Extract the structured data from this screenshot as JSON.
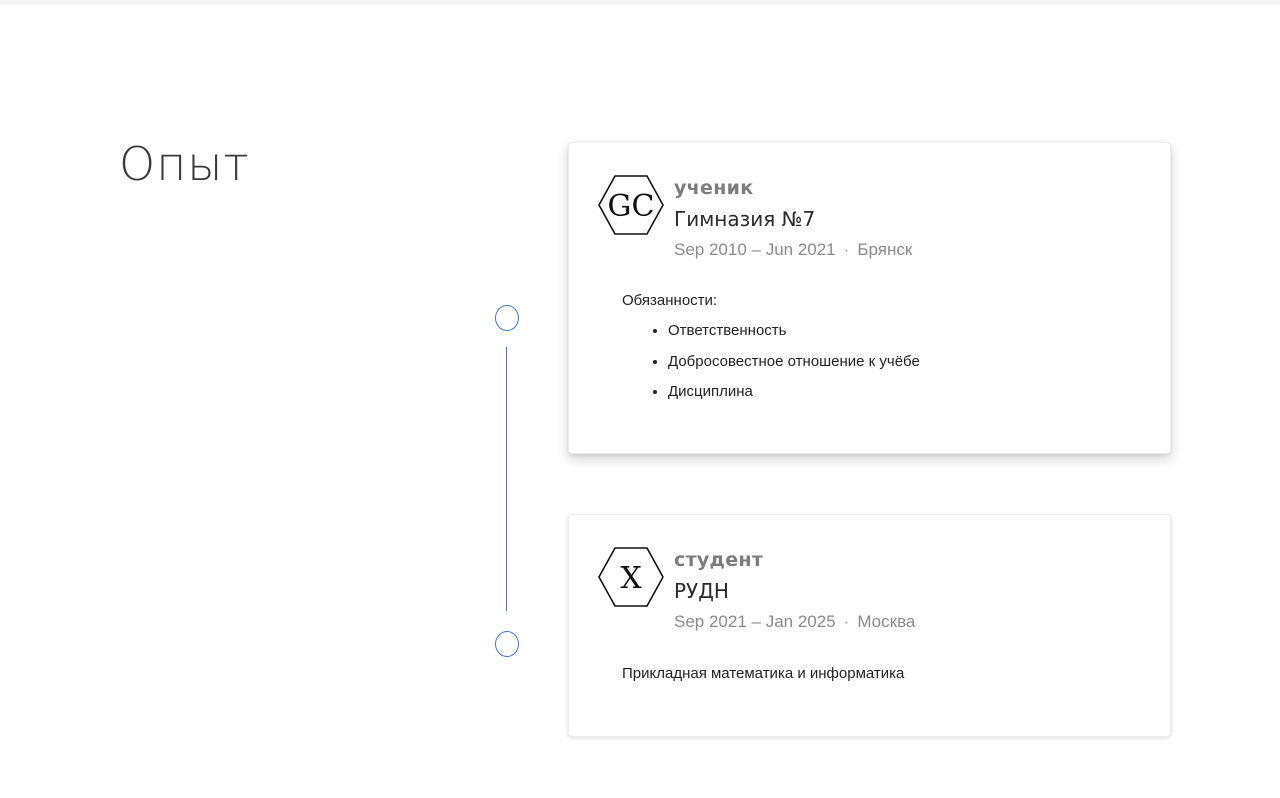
{
  "section": {
    "title": "Опыт"
  },
  "experience": [
    {
      "logo_text": "GC",
      "role": "ученик",
      "organization": "Гимназия №7",
      "dates": "Sep 2010 – Jun 2021",
      "separator": "·",
      "location": "Брянск",
      "duties_label": "Обязанности:",
      "duties": [
        "Ответственность",
        "Добросовестное отношение к учёбе",
        "Дисциплина"
      ]
    },
    {
      "logo_text": "X",
      "role": "студент",
      "organization": "РУДН",
      "dates": "Sep 2021 – Jan 2025",
      "separator": "·",
      "location": "Москва",
      "description": "Прикладная математика и информатика"
    }
  ],
  "colors": {
    "accent": "#3d78d8",
    "title": "#3a3a3a",
    "role": "#7c7c7c",
    "meta": "#8a8a8a"
  }
}
